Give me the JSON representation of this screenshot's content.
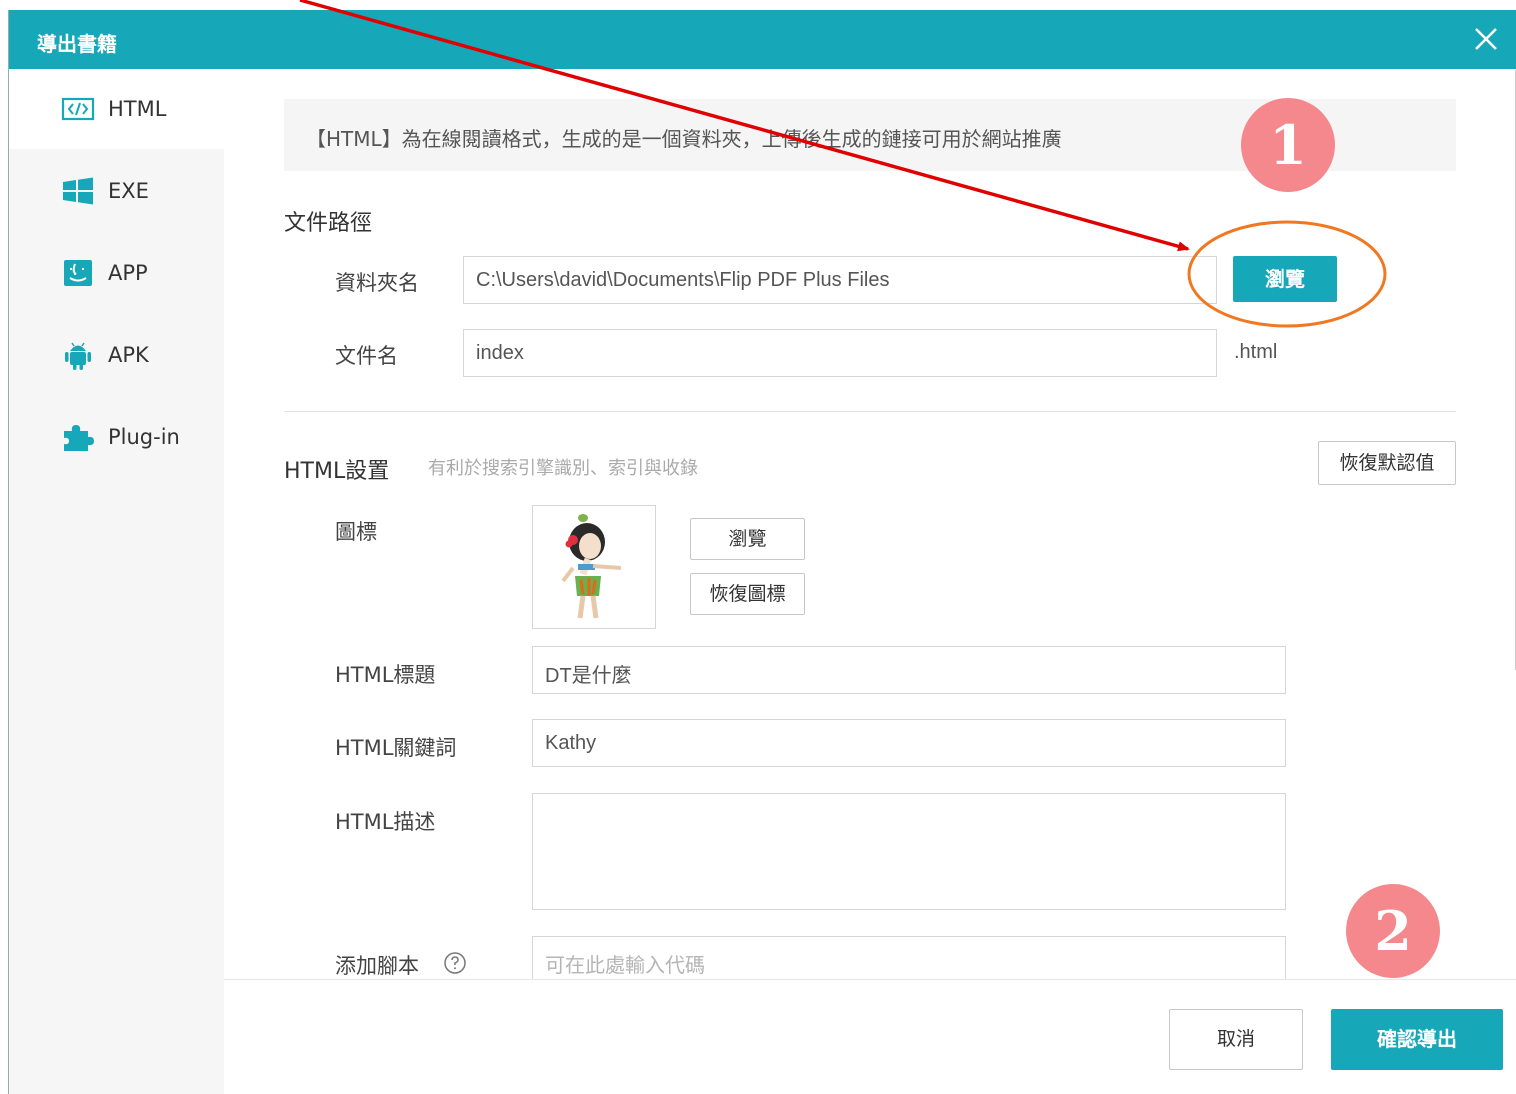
{
  "dialog": {
    "title": "導出書籍",
    "close_icon": "close-icon",
    "accent_color": "#16a8b8"
  },
  "sidebar": {
    "items": [
      {
        "label": "HTML",
        "icon": "html-code-icon",
        "active": true
      },
      {
        "label": "EXE",
        "icon": "windows-icon",
        "active": false
      },
      {
        "label": "APP",
        "icon": "mac-finder-icon",
        "active": false
      },
      {
        "label": "APK",
        "icon": "android-icon",
        "active": false
      },
      {
        "label": "Plug-in",
        "icon": "puzzle-icon",
        "active": false
      }
    ]
  },
  "main": {
    "info_text": "【HTML】為在線閱讀格式，生成的是一個資料夾，上傳後生成的鏈接可用於網站推廣",
    "file_path": {
      "section_title": "文件路徑",
      "folder_label": "資料夾名",
      "folder_value": "C:\\Users\\david\\Documents\\Flip PDF Plus Files",
      "browse_label": "瀏覽",
      "filename_label": "文件名",
      "filename_value": "index",
      "filename_suffix": ".html"
    },
    "html_settings": {
      "section_title": "HTML設置",
      "hint": "有利於搜索引擎識別、索引與收錄",
      "restore_defaults_label": "恢復默認值",
      "icon_label": "圖標",
      "icon_browse_label": "瀏覽",
      "icon_restore_label": "恢復圖標",
      "title_label": "HTML標題",
      "title_value": "DT是什麼",
      "keywords_label": "HTML關鍵詞",
      "keywords_value": "Kathy",
      "description_label": "HTML描述",
      "description_value": "",
      "script_label": "添加腳本",
      "script_help_icon": "question-circle-icon",
      "script_placeholder": "可在此處輸入代碼"
    }
  },
  "footer": {
    "cancel_label": "取消",
    "confirm_label": "確認導出"
  },
  "annotations": {
    "step1": "1",
    "step2": "2",
    "arrow_color": "#e00000",
    "highlight_color": "#f07820",
    "badge_color": "#f4888c"
  }
}
